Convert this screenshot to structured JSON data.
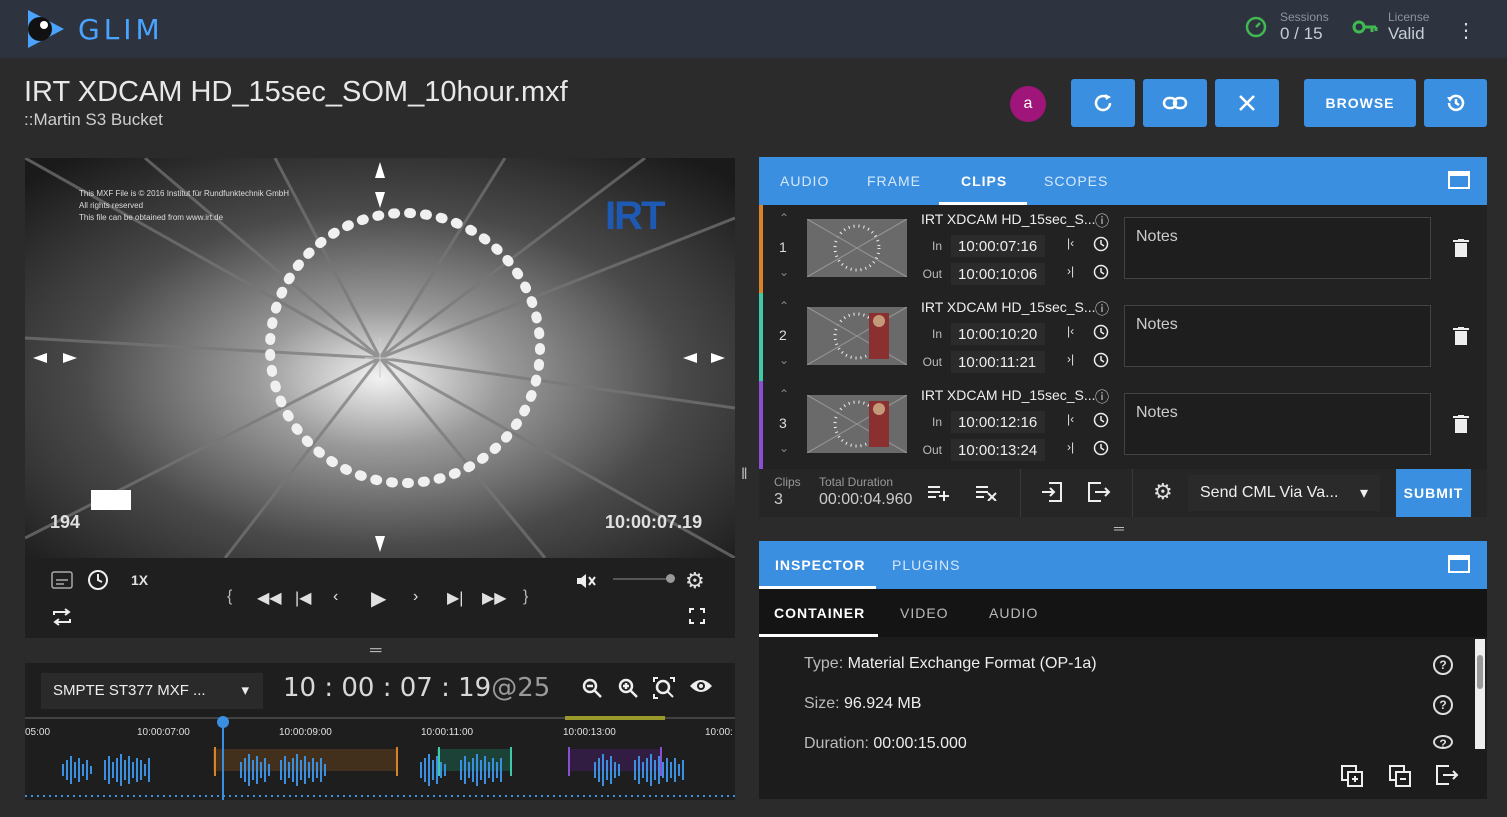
{
  "app": {
    "logo_text": "GLIM"
  },
  "stats": {
    "sessions_label": "Sessions",
    "sessions_value": "0 / 15",
    "license_label": "License",
    "license_value": "Valid"
  },
  "file": {
    "title": "IRT XDCAM HD_15sec_SOM_10hour.mxf",
    "subtitle": "::Martin S3 Bucket"
  },
  "user": {
    "avatar_letter": "a"
  },
  "toolbar": {
    "browse_label": "BROWSE"
  },
  "player": {
    "overlay_frame": "194",
    "overlay_tc": "10:00:07.19",
    "speed": "1X",
    "overlay_copyright": [
      "This MXF File is © 2016 Institut für Rundfunktechnik GmbH",
      "All rights reserved",
      "This file can be obtained from www.irt.de"
    ],
    "logo": "IRT"
  },
  "timeline": {
    "timecode_format": "SMPTE ST377 MXF ...",
    "timecode": "10 : 00 : 07 : 19",
    "fps": "@25",
    "ticks": [
      "05:00",
      "10:00:07:00",
      "10:00:09:00",
      "10:00:11:00",
      "10:00:13:00",
      "10:00:"
    ]
  },
  "clips_panel": {
    "tabs": [
      "AUDIO",
      "FRAME",
      "CLIPS",
      "SCOPES"
    ],
    "active_tab": "CLIPS",
    "clips": [
      {
        "num": "1",
        "name": "IRT XDCAM HD_15sec_S...",
        "in_label": "In",
        "in": "10:00:07:16",
        "out_label": "Out",
        "out": "10:00:10:06",
        "notes": "Notes",
        "color": "#d9822b"
      },
      {
        "num": "2",
        "name": "IRT XDCAM HD_15sec_S...",
        "in_label": "In",
        "in": "10:00:10:20",
        "out_label": "Out",
        "out": "10:00:11:21",
        "notes": "Notes",
        "color": "#3ec9a7"
      },
      {
        "num": "3",
        "name": "IRT XDCAM HD_15sec_S...",
        "in_label": "In",
        "in": "10:00:12:16",
        "out_label": "Out",
        "out": "10:00:13:24",
        "notes": "Notes",
        "color": "#8a4fd0"
      }
    ],
    "footer": {
      "clips_label": "Clips",
      "clips_count": "3",
      "duration_label": "Total Duration",
      "duration_value": "00:00:04.960",
      "send_option": "Send CML Via Va...",
      "submit_label": "SUBMIT"
    }
  },
  "inspector": {
    "tabs": [
      "INSPECTOR",
      "PLUGINS"
    ],
    "active_tab": "INSPECTOR",
    "subtabs": [
      "CONTAINER",
      "VIDEO",
      "AUDIO"
    ],
    "active_subtab": "CONTAINER",
    "props": [
      {
        "label": "Type:",
        "value": "Material Exchange Format (OP-1a)"
      },
      {
        "label": "Size:",
        "value": "96.924 MB"
      },
      {
        "label": "Duration:",
        "value": "00:00:15.000"
      }
    ]
  },
  "colors": {
    "accent": "#3b8fe0",
    "topbar": "#2d3440",
    "avatar": "#a0157a"
  }
}
